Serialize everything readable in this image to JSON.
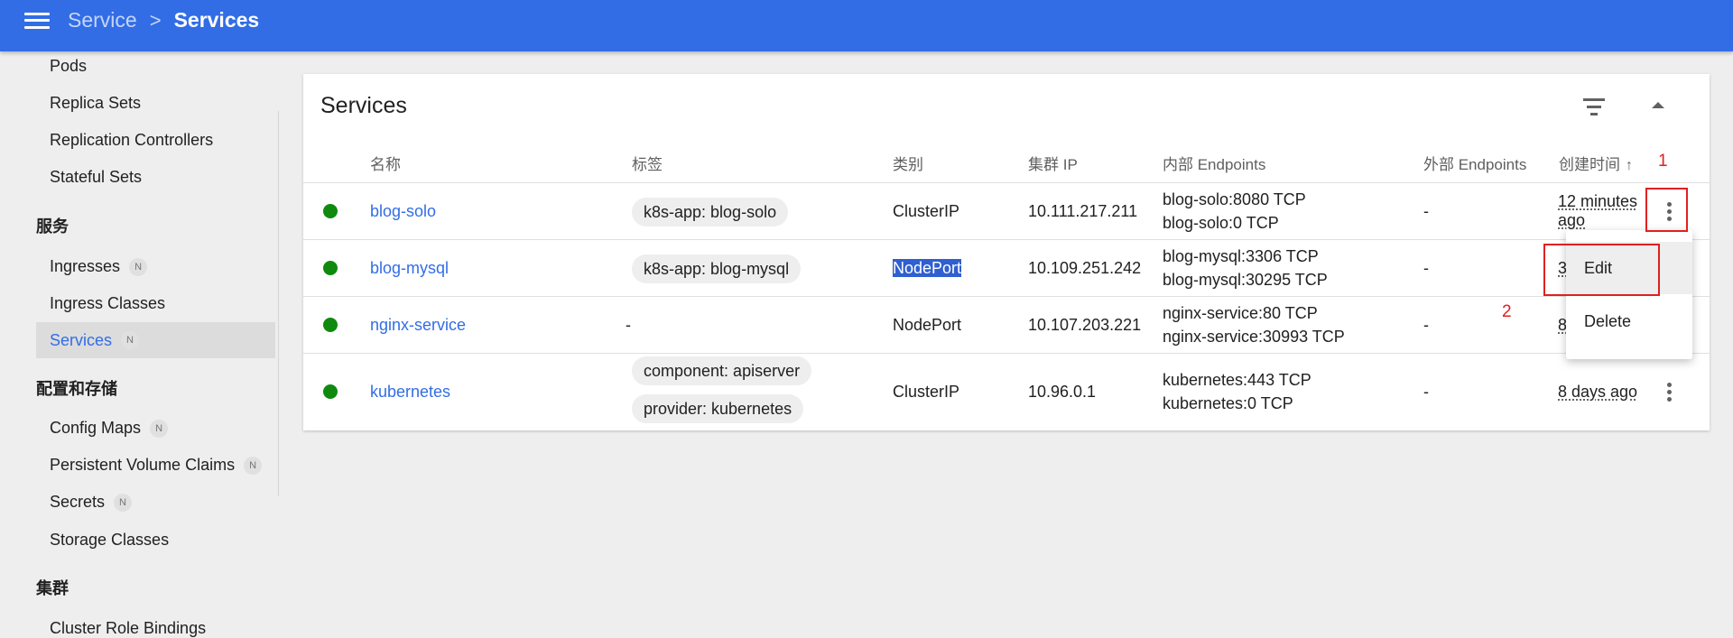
{
  "header": {
    "breadcrumb_parent": "Service",
    "breadcrumb_separator": ">",
    "breadcrumb_current": "Services"
  },
  "sidebar": {
    "items": [
      {
        "label": "Pods"
      },
      {
        "label": "Replica Sets"
      },
      {
        "label": "Replication Controllers"
      },
      {
        "label": "Stateful Sets"
      },
      {
        "label": "服务",
        "section": true
      },
      {
        "label": "Ingresses",
        "badge": "N"
      },
      {
        "label": "Ingress Classes"
      },
      {
        "label": "Services",
        "badge": "N",
        "active": true
      },
      {
        "label": "配置和存储",
        "section": true
      },
      {
        "label": "Config Maps",
        "badge": "N"
      },
      {
        "label": "Persistent Volume Claims",
        "badge": "N"
      },
      {
        "label": "Secrets",
        "badge": "N"
      },
      {
        "label": "Storage Classes"
      },
      {
        "label": "集群",
        "section": true
      },
      {
        "label": "Cluster Role Bindings"
      }
    ]
  },
  "card": {
    "title": "Services",
    "columns": [
      "名称",
      "标签",
      "类别",
      "集群 IP",
      "内部 Endpoints",
      "外部 Endpoints",
      "创建时间"
    ],
    "sort_indicator": "↑",
    "rows": [
      {
        "name": "blog-solo",
        "labels": [
          "k8s-app: blog-solo"
        ],
        "type": "ClusterIP",
        "cluster_ip": "10.111.217.211",
        "internal_endpoints": [
          "blog-solo:8080 TCP",
          "blog-solo:0 TCP"
        ],
        "external_endpoints": "-",
        "created": [
          "12 minutes",
          "ago"
        ]
      },
      {
        "name": "blog-mysql",
        "labels": [
          "k8s-app: blog-mysql"
        ],
        "type": "NodePort",
        "cluster_ip": "10.109.251.242",
        "internal_endpoints": [
          "blog-mysql:3306 TCP",
          "blog-mysql:30295 TCP"
        ],
        "external_endpoints": "-",
        "created": [
          "3"
        ]
      },
      {
        "name": "nginx-service",
        "labels": "-",
        "type": "NodePort",
        "cluster_ip": "10.107.203.221",
        "internal_endpoints": [
          "nginx-service:80 TCP",
          "nginx-service:30993 TCP"
        ],
        "external_endpoints": "-",
        "created": [
          "8"
        ]
      },
      {
        "name": "kubernetes",
        "labels": [
          "component: apiserver",
          "provider: kubernetes"
        ],
        "type": "ClusterIP",
        "cluster_ip": "10.96.0.1",
        "internal_endpoints": [
          "kubernetes:443 TCP",
          "kubernetes:0 TCP"
        ],
        "external_endpoints": "-",
        "created": [
          "8 days ago"
        ]
      }
    ]
  },
  "context_menu": {
    "items": [
      "Edit",
      "Delete"
    ]
  },
  "annotations": {
    "step1": "1",
    "step2": "2",
    "color": "#e02020"
  },
  "colors": {
    "topbar": "#326de6",
    "link": "#326de6",
    "status_ok": "#0f8a0f"
  }
}
